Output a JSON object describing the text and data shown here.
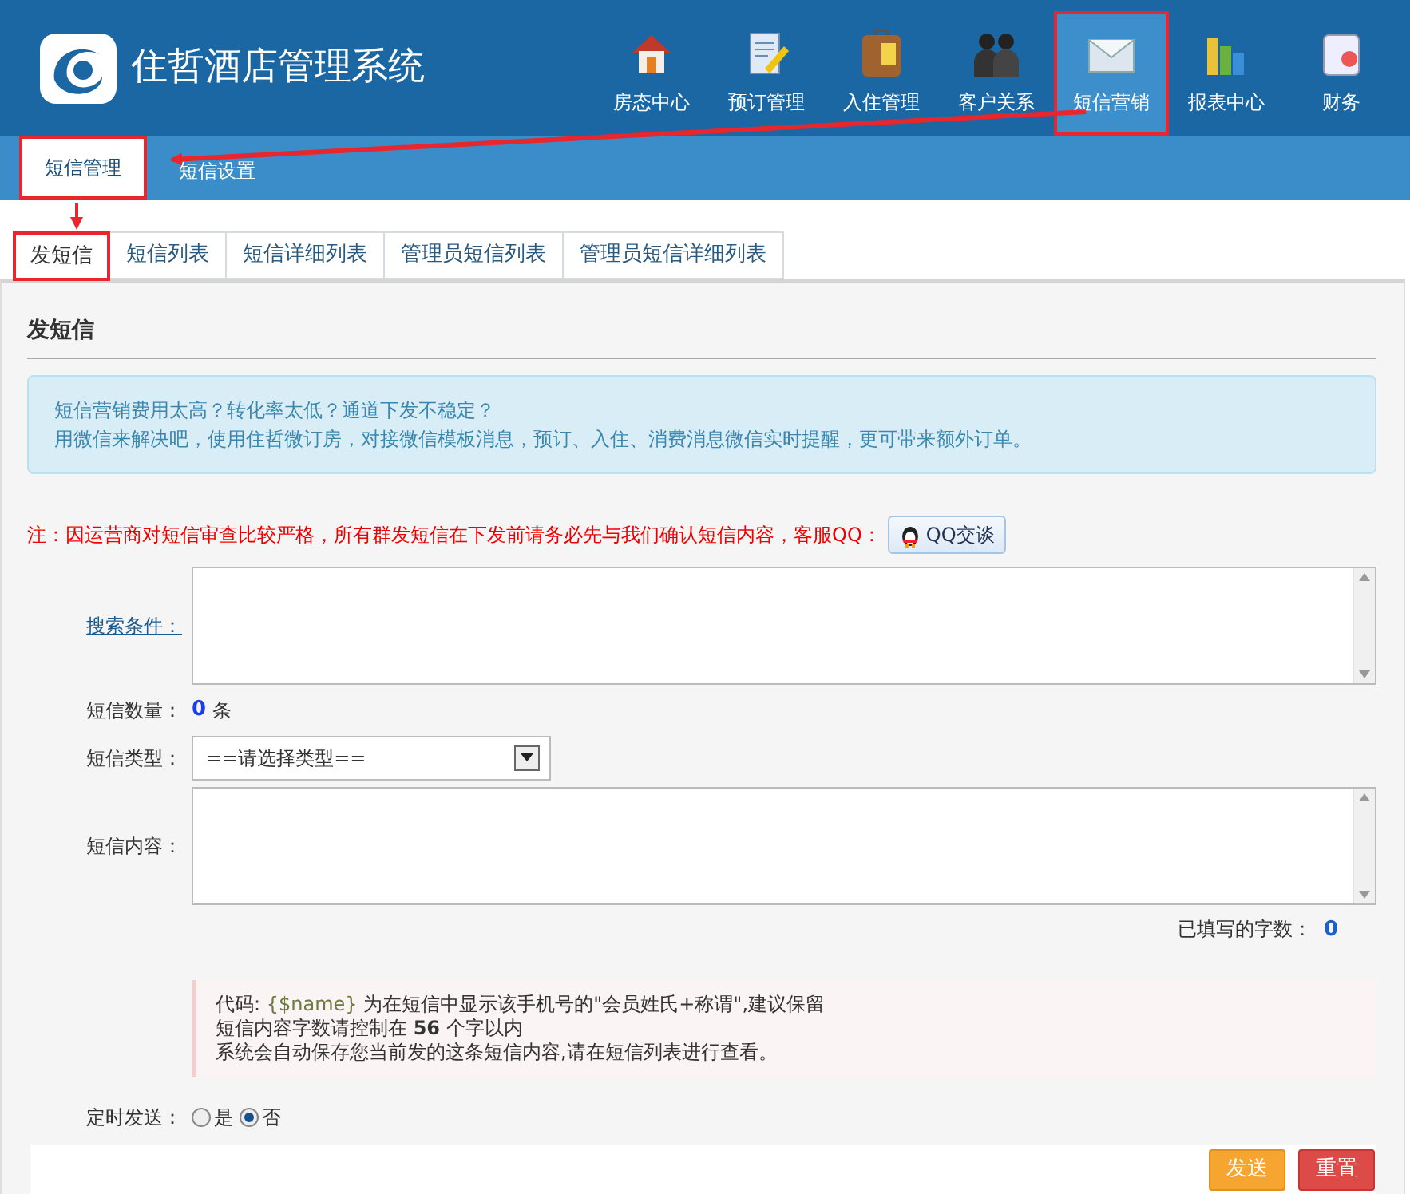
{
  "app": {
    "title": "住哲酒店管理系统"
  },
  "nav": [
    {
      "label": "房态中心",
      "selected": false,
      "highlighted": false
    },
    {
      "label": "预订管理",
      "selected": false,
      "highlighted": false
    },
    {
      "label": "入住管理",
      "selected": false,
      "highlighted": false
    },
    {
      "label": "客户关系",
      "selected": false,
      "highlighted": false
    },
    {
      "label": "短信营销",
      "selected": true,
      "highlighted": true
    },
    {
      "label": "报表中心",
      "selected": false,
      "highlighted": false
    },
    {
      "label": "财务",
      "selected": false,
      "highlighted": false
    }
  ],
  "subnav": [
    {
      "label": "短信管理",
      "selected": true,
      "highlighted": true
    },
    {
      "label": "短信设置",
      "selected": false,
      "highlighted": false
    }
  ],
  "tabs": [
    {
      "label": "发短信",
      "selected": true,
      "highlighted": true
    },
    {
      "label": "短信列表",
      "selected": false,
      "highlighted": false
    },
    {
      "label": "短信详细列表",
      "selected": false,
      "highlighted": false
    },
    {
      "label": "管理员短信列表",
      "selected": false,
      "highlighted": false
    },
    {
      "label": "管理员短信详细列表",
      "selected": false,
      "highlighted": false
    }
  ],
  "section_title": "发短信",
  "promo": [
    "短信营销费用太高？转化率太低？通道下发不稳定？",
    "用微信来解决吧，使用住哲微订房，对接微信模板消息，预订、入住、消费消息微信实时提醒，更可带来额外订单。"
  ],
  "notice": {
    "text": "注：因运营商对短信审查比较严格，所有群发短信在下发前请务必先与我们确认短信内容，客服QQ：",
    "button": "QQ交谈"
  },
  "form": {
    "search_label": "搜索条件：",
    "count_label": "短信数量：",
    "count": "0",
    "count_unit": "条",
    "type_label": "短信类型：",
    "type_value": "==请选择类型==",
    "content_label": "短信内容：",
    "filled_label": "已填写的字数：",
    "filled": "0"
  },
  "hints": [
    {
      "kind": "code",
      "label": "代码:",
      "code": "{$name}",
      "text": "为在短信中显示该手机号的\"会员姓氏+称谓\",建议保留"
    },
    {
      "kind": "text",
      "text": "短信内容字数请控制在 **56** 个字以内"
    },
    {
      "kind": "text",
      "text": "系统会自动保存您当前发的这条短信内容,请在短信列表进行查看。"
    }
  ],
  "schedule": {
    "label": "定时发送：",
    "options": [
      {
        "label": "是",
        "selected": false
      },
      {
        "label": "否",
        "selected": true
      }
    ]
  },
  "buttons": [
    {
      "label": "发送",
      "kind": "warning"
    },
    {
      "label": "重置",
      "kind": "danger"
    }
  ]
}
